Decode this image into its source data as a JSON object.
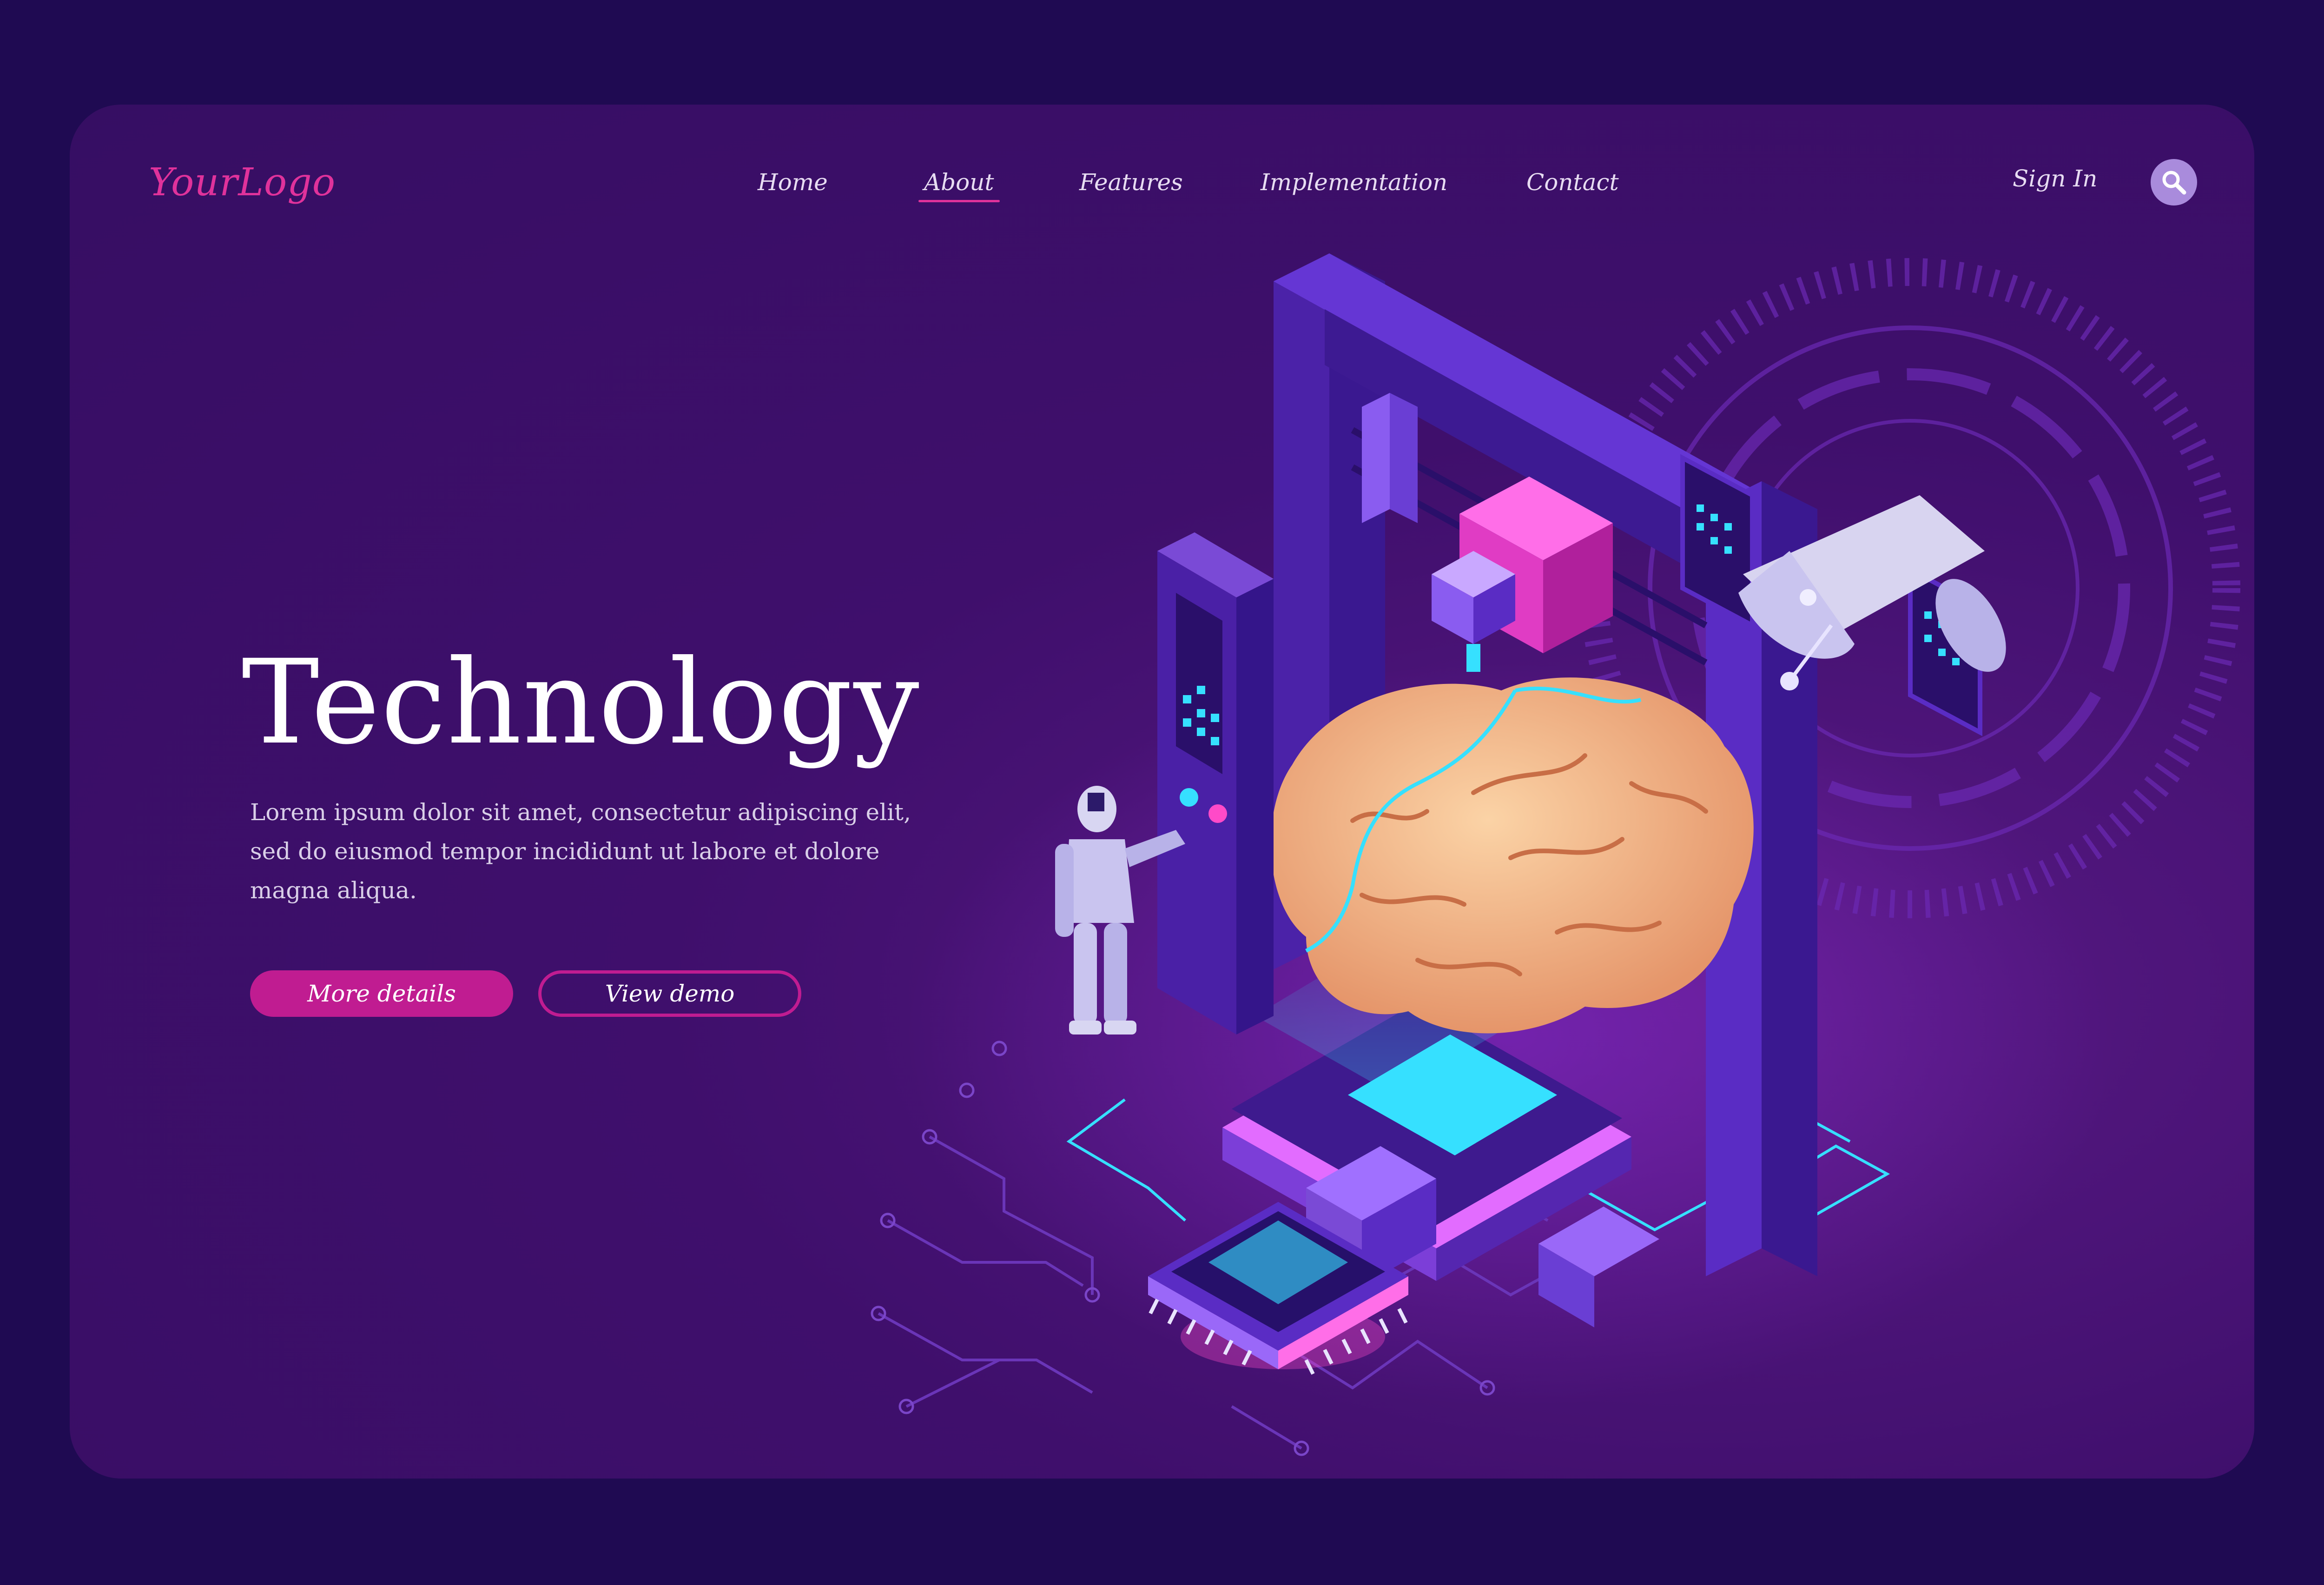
{
  "header": {
    "logo": "YourLogo",
    "nav": [
      "Home",
      "About",
      "Features",
      "Implementation",
      "Contact"
    ],
    "active_nav": "About",
    "sign_in": "Sign In",
    "search_icon": "search-icon"
  },
  "hero": {
    "title": "Technology",
    "description": "Lorem ipsum dolor sit amet, consectetur adipiscing elit, sed do eiusmod tempor incididunt ut labore et dolore magna aliqua.",
    "primary_button": "More details",
    "secondary_button": "View demo"
  },
  "illustration": {
    "subject": "isometric 3D printer printing a brain, robot pressing control panel, microchip and satellite",
    "colors": {
      "background": "#1f0a52",
      "card": "#3f0f6c",
      "accent_pink": "#e0329b",
      "button_magenta": "#c01c91",
      "cyan": "#36e0ff",
      "brain": "#f3b88a"
    }
  }
}
